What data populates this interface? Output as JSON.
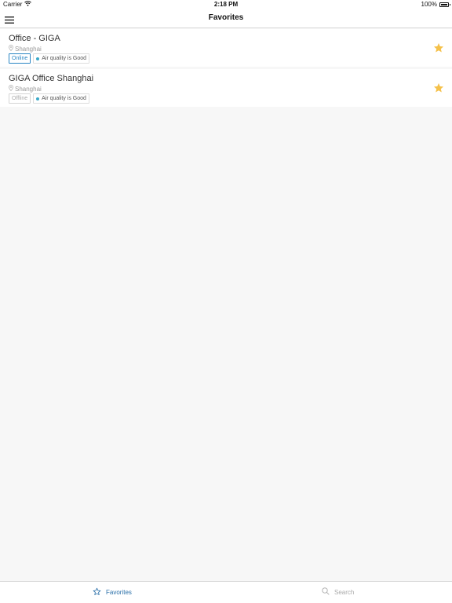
{
  "status_bar": {
    "carrier": "Carrier",
    "time": "2:18 PM",
    "battery": "100%"
  },
  "nav": {
    "title": "Favorites"
  },
  "favorites": [
    {
      "name": "Office - GIGA",
      "location": "Shanghai",
      "status": "Online",
      "air_quality": "Air quality is Good",
      "favorited": true
    },
    {
      "name": "GIGA Office Shanghai",
      "location": "Shanghai",
      "status": "Offline",
      "air_quality": "Air quality is Good",
      "favorited": true
    }
  ],
  "tab_bar": {
    "favorites_label": "Favorites",
    "search_label": "Search"
  },
  "colors": {
    "accent": "#2a6fa8",
    "online": "#2a86c4",
    "star": "#f5c14a",
    "air_dot": "#3aa9c8"
  },
  "icons": {
    "menu": "hamburger-menu-icon",
    "wifi": "wifi-icon",
    "battery": "battery-icon",
    "location": "location-pin-icon",
    "star": "star-icon",
    "tab_favorites": "star-outline-icon",
    "tab_search": "search-icon"
  }
}
